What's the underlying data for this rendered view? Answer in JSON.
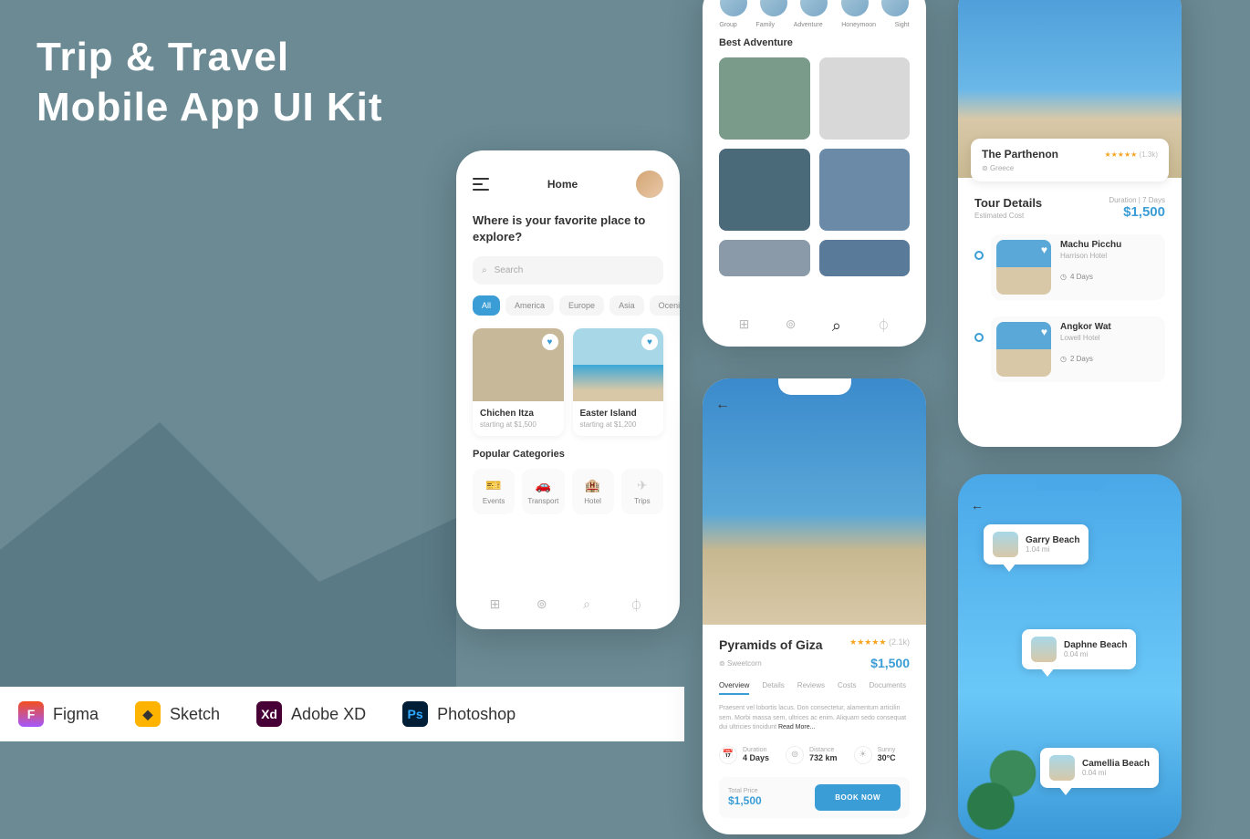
{
  "hero": {
    "line1": "Trip & Travel",
    "line2": "Mobile App UI Kit"
  },
  "compat": {
    "figma": "Figma",
    "sketch": "Sketch",
    "xd": "Adobe XD",
    "ps": "Photoshop"
  },
  "phone1": {
    "header_title": "Home",
    "question": "Where is your favorite place to explore?",
    "search_placeholder": "Search",
    "chips": {
      "all": "All",
      "america": "America",
      "europe": "Europe",
      "asia": "Asia",
      "ocenia": "Ocenia"
    },
    "card1": {
      "title": "Chichen Itza",
      "sub": "starting at $1,500"
    },
    "card2": {
      "title": "Easter Island",
      "sub": "starting at $1,200"
    },
    "popular_label": "Popular Categories",
    "cats": {
      "events": "Events",
      "transport": "Transport",
      "hotel": "Hotel",
      "trips": "Trips"
    }
  },
  "phone2": {
    "avlabels": {
      "group": "Group",
      "family": "Family",
      "adventure": "Adventure",
      "honeymoon": "Honeymoon",
      "sight": "Sight"
    },
    "section": "Best Adventure"
  },
  "phone3": {
    "title": "Pyramids of Giza",
    "stars": "★★★★★",
    "rating_count": "(2.1k)",
    "location": "Sweetcorn",
    "price": "$1,500",
    "tabs": {
      "overview": "Overview",
      "details": "Details",
      "reviews": "Reviews",
      "costs": "Costs",
      "documents": "Documents"
    },
    "desc": "Praesent vel lobortis lacus. Don consectetur, alamentum articilin sem. Morbi massa sem, ultrices ac enim. Aliquam sedo consequat dui ultricies tincidunt ",
    "readmore": "Read More...",
    "stats": {
      "duration_lbl": "Duration",
      "duration_val": "4 Days",
      "distance_lbl": "Distance",
      "distance_val": "732 km",
      "weather_lbl": "Sunny",
      "weather_val": "30°C"
    },
    "total_lbl": "Total Price",
    "total_val": "$1,500",
    "book": "BOOK NOW"
  },
  "phone4": {
    "float": {
      "title": "The Parthenon",
      "stars": "★★★★★",
      "count": "(1.3k)",
      "location": "Greece"
    },
    "td_title": "Tour Details",
    "duration": "Duration | 7 Days",
    "est": "Estimated Cost",
    "price": "$1,500",
    "items": [
      {
        "title": "Machu Picchu",
        "sub": "Harrison Hotel",
        "days": "4 Days"
      },
      {
        "title": "Angkor Wat",
        "sub": "Lowell Hotel",
        "days": "2 Days"
      }
    ]
  },
  "phone5": {
    "pins": [
      {
        "title": "Garry Beach",
        "dist": "1.04 mi"
      },
      {
        "title": "Daphne Beach",
        "dist": "0.04 mi"
      },
      {
        "title": "Camellia Beach",
        "dist": "0.04 mi"
      }
    ]
  }
}
